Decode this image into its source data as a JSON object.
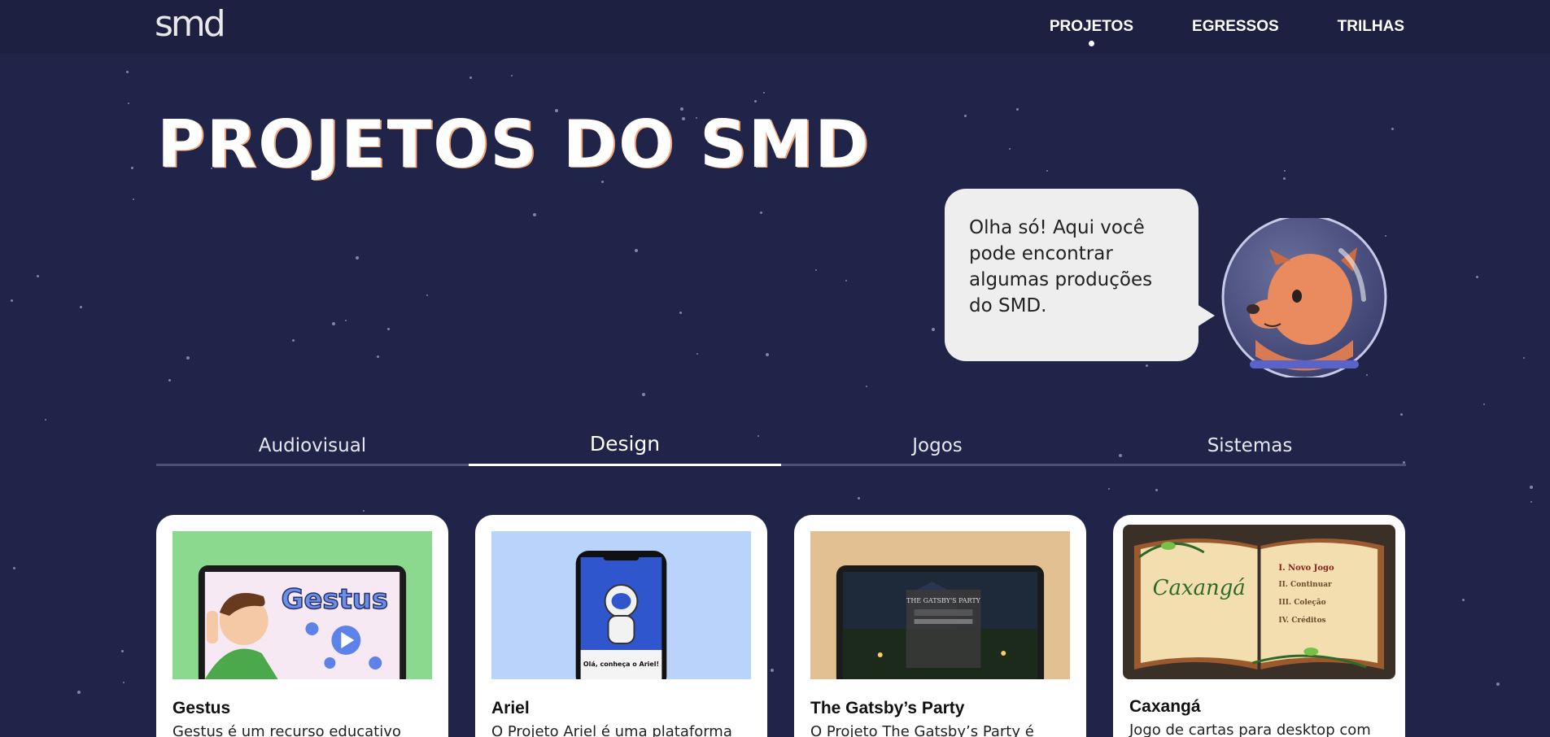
{
  "header": {
    "logo": "smd",
    "nav": [
      {
        "label": "PROJETOS",
        "active": true
      },
      {
        "label": "EGRESSOS",
        "active": false
      },
      {
        "label": "TRILHAS",
        "active": false
      }
    ]
  },
  "hero": {
    "title": "PROJETOS DO SMD",
    "bubble_text": "Olha só! Aqui você pode encontrar algumas produções do SMD."
  },
  "tabs": [
    {
      "label": "Audiovisual",
      "active": false
    },
    {
      "label": "Design",
      "active": true
    },
    {
      "label": "Jogos",
      "active": false
    },
    {
      "label": "Sistemas",
      "active": false
    }
  ],
  "cards": [
    {
      "title": "Gestus",
      "description": "Gestus é um recurso educativo",
      "thumb_bg": "#8bd98e",
      "thumb_text": "Gestus"
    },
    {
      "title": "Ariel",
      "description": "O Projeto Ariel é uma plataforma",
      "thumb_bg": "#b9d3fa",
      "thumb_text": "Olá, conheça o Ariel!"
    },
    {
      "title": "The Gatsby’s Party",
      "description": "O Projeto The Gatsby’s Party é",
      "thumb_bg": "#e3c092",
      "thumb_text": "THE GATSBY'S PARTY"
    },
    {
      "title": "Caxangá",
      "description": "Jogo de cartas para desktop com",
      "thumb_bg": "#3b3028",
      "thumb_text": "Caxangá",
      "menu": [
        "I. Novo Jogo",
        "II. Continuar",
        "III. Coleção",
        "IV. Créditos"
      ]
    }
  ]
}
